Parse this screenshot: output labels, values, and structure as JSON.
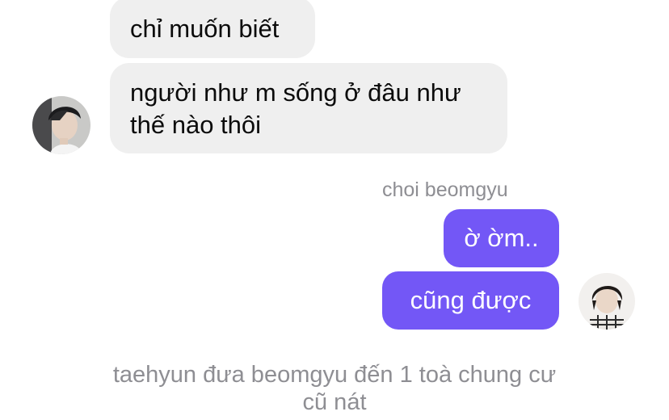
{
  "conversation": {
    "incoming": {
      "messages": [
        {
          "lines": [
            "chỉ muốn biết"
          ]
        },
        {
          "lines": [
            "người như m sống ở đâu như",
            "thế nào thôi"
          ]
        }
      ],
      "avatar_icon": "boy-portrait-avatar-icon"
    },
    "outgoing": {
      "sender_name": "choi beomgyu",
      "messages": [
        {
          "text": "ờ ờm.."
        },
        {
          "text": "cũng được"
        }
      ],
      "avatar_icon": "beomgyu-portrait-avatar-icon"
    },
    "narration": {
      "lines": [
        "taehyun đưa beomgyu đến 1 toà chung cư",
        "cũ nát"
      ]
    }
  },
  "colors": {
    "incoming_bubble": "#efefef",
    "outgoing_bubble": "#7357f6",
    "caption_text": "#8e8e93"
  }
}
